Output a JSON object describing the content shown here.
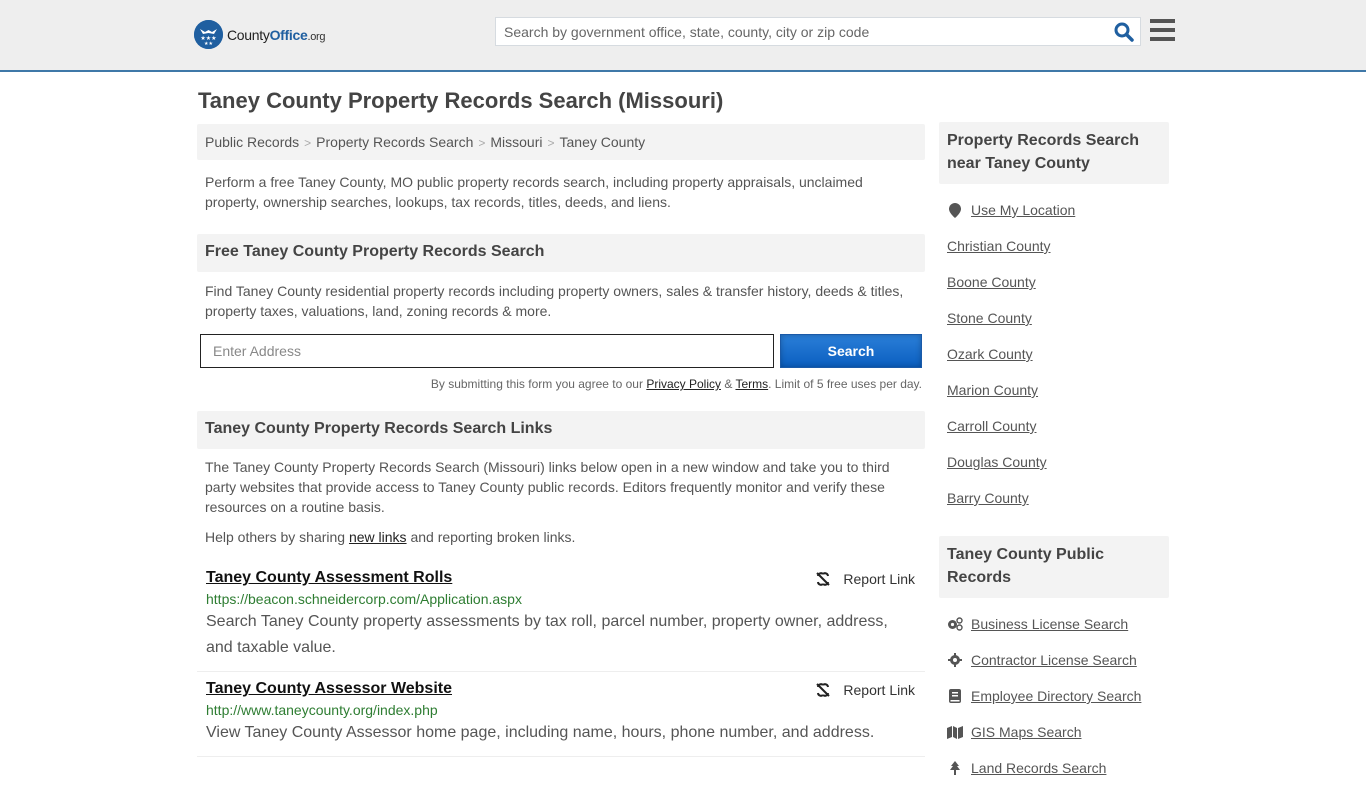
{
  "header": {
    "logo_county": "County",
    "logo_office": "Office",
    "logo_org": ".org",
    "search_placeholder": "Search by government office, state, county, city or zip code"
  },
  "page_title": "Taney County Property Records Search (Missouri)",
  "breadcrumb": [
    "Public Records",
    "Property Records Search",
    "Missouri",
    "Taney County"
  ],
  "intro": "Perform a free Taney County, MO public property records search, including property appraisals, unclaimed property, ownership searches, lookups, tax records, titles, deeds, and liens.",
  "free_search": {
    "heading": "Free Taney County Property Records Search",
    "description": "Find Taney County residential property records including property owners, sales & transfer history, deeds & titles, property taxes, valuations, land, zoning records & more.",
    "address_placeholder": "Enter Address",
    "button_label": "Search",
    "disclaimer_prefix": "By submitting this form you agree to our ",
    "privacy_label": "Privacy Policy",
    "amp": " & ",
    "terms_label": "Terms",
    "disclaimer_suffix": ". Limit of 5 free uses per day."
  },
  "links_section": {
    "heading": "Taney County Property Records Search Links",
    "description": "The Taney County Property Records Search (Missouri) links below open in a new window and take you to third party websites that provide access to Taney County public records. Editors frequently monitor and verify these resources on a routine basis.",
    "help_prefix": "Help others by sharing ",
    "help_link": "new links",
    "help_suffix": " and reporting broken links.",
    "report_label": "Report Link",
    "items": [
      {
        "title": "Taney County Assessment Rolls",
        "url": "https://beacon.schneidercorp.com/Application.aspx",
        "description": "Search Taney County property assessments by tax roll, parcel number, property owner, address, and taxable value."
      },
      {
        "title": "Taney County Assessor Website",
        "url": "http://www.taneycounty.org/index.php",
        "description": "View Taney County Assessor home page, including name, hours, phone number, and address."
      }
    ]
  },
  "sidebar": {
    "nearby_heading": "Property Records Search near Taney County",
    "use_location": "Use My Location",
    "nearby": [
      "Christian County",
      "Boone County",
      "Stone County",
      "Ozark County",
      "Marion County",
      "Carroll County",
      "Douglas County",
      "Barry County"
    ],
    "public_heading": "Taney County Public Records",
    "public_records": [
      {
        "label": "Business License Search",
        "icon": "gears-icon"
      },
      {
        "label": "Contractor License Search",
        "icon": "gear-icon"
      },
      {
        "label": "Employee Directory Search",
        "icon": "book-icon"
      },
      {
        "label": "GIS Maps Search",
        "icon": "map-icon"
      },
      {
        "label": "Land Records Search",
        "icon": "tree-icon"
      }
    ]
  },
  "colors": {
    "brand_blue": "#1f5fa0",
    "header_border": "#3f78a8",
    "button_blue": "#0b5fc0",
    "url_green": "#2e7d32"
  }
}
